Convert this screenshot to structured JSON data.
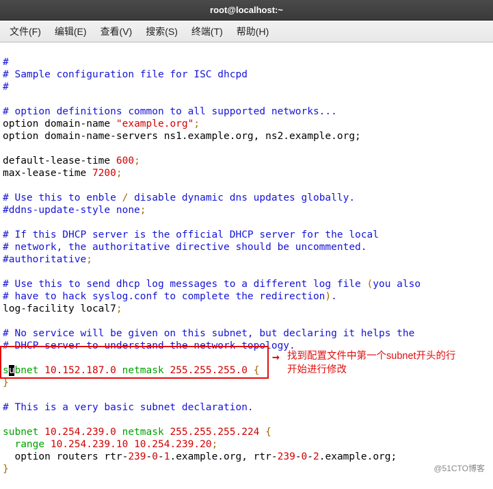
{
  "window": {
    "title": "root@localhost:~"
  },
  "menu": {
    "file": "文件(F)",
    "edit": "编辑(E)",
    "view": "查看(V)",
    "search": "搜索(S)",
    "terminal": "终端(T)",
    "help": "帮助(H)"
  },
  "text": {
    "l01": "#",
    "l02": "# Sample configuration file for ISC dhcpd",
    "l03": "#",
    "l04": "",
    "l05": "# option definitions common to all supported networks...",
    "l06a": "option domain-name ",
    "l06b": "\"example.org\"",
    "l06c": ";",
    "l07": "option domain-name-servers ns1.example.org, ns2.example.org;",
    "l08": "",
    "l09a": "default-lease-time ",
    "l09b": "600",
    "l09c": ";",
    "l10a": "max-lease-time ",
    "l10b": "7200",
    "l10c": ";",
    "l11": "",
    "l12a": "# Use this to enble ",
    "l12b": "/",
    "l12c": " disable dynamic dns updates globally.",
    "l13a": "#ddns-update-style none",
    "l13b": ";",
    "l14": "",
    "l15": "# If this DHCP server is the official DHCP server for the local",
    "l16": "# network, the authoritative directive should be uncommented.",
    "l17a": "#authoritative",
    "l17b": ";",
    "l18": "",
    "l19a": "# Use this to send dhcp log messages to a different log file ",
    "l19b": "(",
    "l19c": "you also",
    "l20a": "# have to hack syslog.conf to complete the redirection",
    "l20b": ")",
    "l20c": ".",
    "l21a": "log-facility local7",
    "l21b": ";",
    "l22": "",
    "l23": "# No service will be given on this subnet, but declaring it helps the",
    "l24": "# DHCP server to understand the network topology.",
    "l25": "",
    "l26_pre": "s",
    "l26_cur": "u",
    "l26a": "bnet ",
    "l26b": "10.152.187.0",
    "l26c": " netmask ",
    "l26d": "255.255.255.0",
    "l26e": " {",
    "l27": "}",
    "l28": "",
    "l29": "# This is a very basic subnet declaration.",
    "l30": "",
    "l31a": "subnet ",
    "l31b": "10.254.239.0",
    "l31c": " netmask ",
    "l31d": "255.255.255.224",
    "l31e": " {",
    "l32a": "  range ",
    "l32b": "10.254.239.10",
    "l32c": " ",
    "l32d": "10.254.239.20",
    "l32e": ";",
    "l33a": "  option routers rtr-",
    "l33b": "239",
    "l33c": "-",
    "l33d": "0",
    "l33e": "-",
    "l33f": "1",
    "l33g": ".example.org, rtr-",
    "l33h": "239",
    "l33i": "-",
    "l33j": "0",
    "l33k": "-",
    "l33l": "2",
    "l33m": ".example.org;",
    "l34": "}",
    "l35": ""
  },
  "annot": {
    "arrow": "→",
    "line1": "找到配置文件中第一个subnet开头的行",
    "line2": "开始进行修改"
  },
  "watermark": "@51CTO博客"
}
